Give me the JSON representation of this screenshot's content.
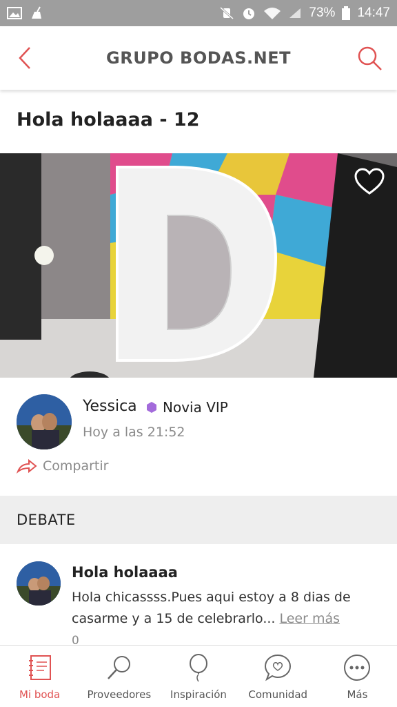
{
  "status_bar": {
    "battery": "73%",
    "time": "14:47",
    "left_icons": [
      "image-icon",
      "cleaning-icon"
    ],
    "right_icons": [
      "vibrate-mute-icon",
      "alarm-icon",
      "wifi-icon",
      "signal-icon",
      "battery-icon"
    ]
  },
  "header": {
    "title": "GRUPO BODAS.NET",
    "accent": "#e05252"
  },
  "post": {
    "title": "Hola holaaaa - 12"
  },
  "author": {
    "name": "Yessica",
    "badge": "Novia VIP",
    "badge_color": "#a36bdb",
    "time": "Hoy a las 21:52"
  },
  "share": {
    "label": "Compartir"
  },
  "debate": {
    "section_label": "DEBATE",
    "comment": {
      "title": "Hola holaaaa",
      "text": "Hola chicassss.Pues aqui estoy a 8 dias de casarme y a 15 de celebrarlo...",
      "read_more": "Leer más",
      "count": "0"
    }
  },
  "nav": {
    "items": [
      {
        "label": "Mi boda",
        "icon": "notebook-icon",
        "active": true
      },
      {
        "label": "Proveedores",
        "icon": "search-icon",
        "active": false
      },
      {
        "label": "Inspiración",
        "icon": "balloon-icon",
        "active": false
      },
      {
        "label": "Comunidad",
        "icon": "chat-heart-icon",
        "active": false
      },
      {
        "label": "Más",
        "icon": "more-icon",
        "active": false
      }
    ]
  }
}
